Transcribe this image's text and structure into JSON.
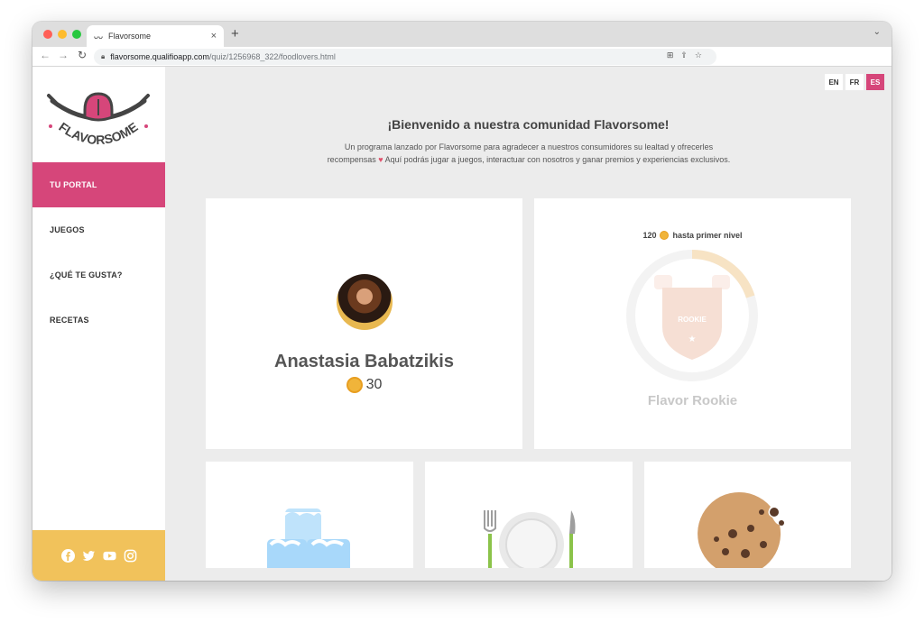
{
  "browser": {
    "tab_title": "Flavorsome",
    "tab_favicon": "ᴗᴗ",
    "close": "×",
    "new_tab": "+",
    "url_host": "flavorsome.qualifioapp.com",
    "url_path": "/quiz/1256968_322/foodlovers.html"
  },
  "sidebar": {
    "logo_text": "FLAVORSOME",
    "items": [
      {
        "label": "TU PORTAL",
        "active": true
      },
      {
        "label": "JUEGOS",
        "active": false
      },
      {
        "label": "¿QUÉ TE GUSTA?",
        "active": false
      },
      {
        "label": "RECETAS",
        "active": false
      }
    ],
    "social_icons": [
      "facebook-icon",
      "twitter-icon",
      "youtube-icon",
      "instagram-icon"
    ]
  },
  "languages": [
    {
      "code": "EN",
      "active": false
    },
    {
      "code": "FR",
      "active": false
    },
    {
      "code": "ES",
      "active": true
    }
  ],
  "welcome": {
    "title": "¡Bienvenido a nuestra comunidad Flavorsome!",
    "text_1": "Un programa lanzado por Flavorsome para agradecer a nuestros consumidores su lealtad y ofrecerles",
    "text_2a": "recompensas",
    "text_2b": "Aquí podrás jugar a juegos, interactuar con nosotros y ganar premios y experiencias exclusivos."
  },
  "profile": {
    "name": "Anastasia Babatzikis",
    "points": "30"
  },
  "level": {
    "points_needed": "120",
    "caption": "hasta primer nivel",
    "badge_label": "ROOKIE",
    "name": "Flavor Rookie",
    "progress": 0.2
  },
  "colors": {
    "accent": "#d6467a",
    "social_bg": "#f1c25b",
    "coin": "#f0b43a"
  }
}
